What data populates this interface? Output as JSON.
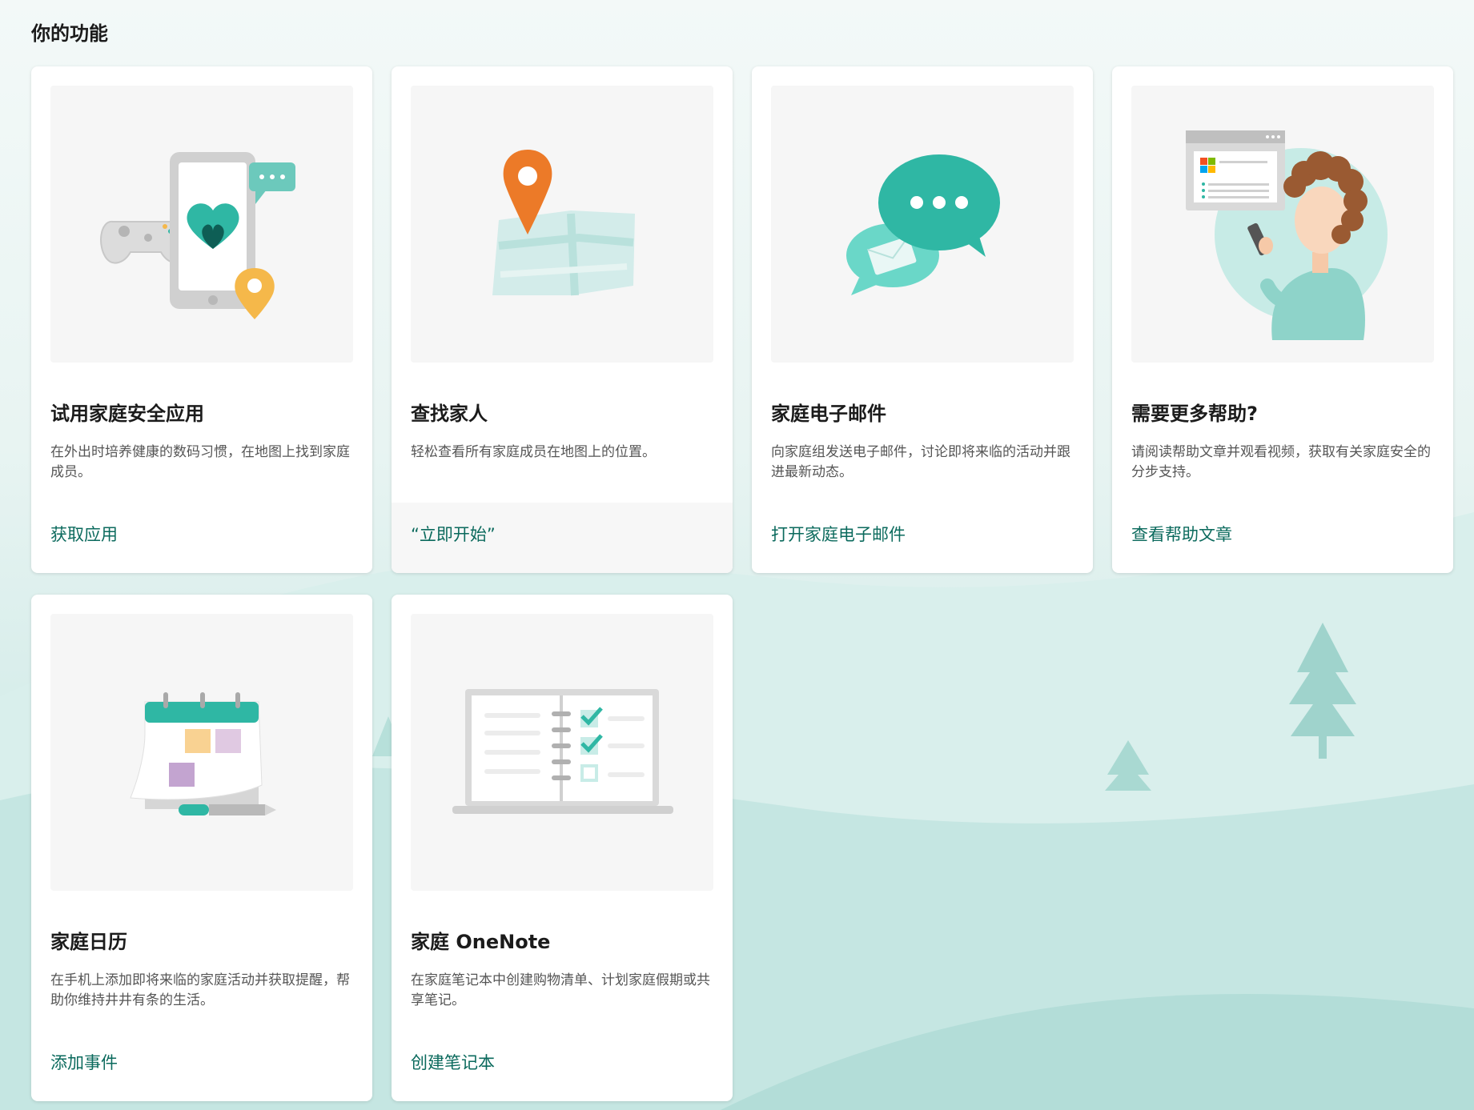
{
  "page": {
    "title": "你的功能"
  },
  "colors": {
    "accent": "#0b6a5d",
    "teal": "#2fb7a4",
    "orange": "#ec7a28",
    "yellow": "#f5b84a"
  },
  "cards": [
    {
      "title": "试用家庭安全应用",
      "description": "在外出时培养健康的数码习惯，在地图上找到家庭成员。",
      "link": "获取应用",
      "icon": "family-safety-app-illustration"
    },
    {
      "title": "查找家人",
      "description": "轻松查看所有家庭成员在地图上的位置。",
      "link": "“立即开始”",
      "icon": "map-location-illustration"
    },
    {
      "title": "家庭电子邮件",
      "description": "向家庭组发送电子邮件，讨论即将来临的活动并跟进最新动态。",
      "link": "打开家庭电子邮件",
      "icon": "email-chat-illustration"
    },
    {
      "title": "需要更多帮助?",
      "description": "请阅读帮助文章并观看视频，获取有关家庭安全的分步支持。",
      "link": "查看帮助文章",
      "icon": "help-person-illustration"
    },
    {
      "title": "家庭日历",
      "description": "在手机上添加即将来临的家庭活动并获取提醒，帮助你维持井井有条的生活。",
      "link": "添加事件",
      "icon": "calendar-illustration"
    },
    {
      "title": "家庭 OneNote",
      "description": "在家庭笔记本中创建购物清单、计划家庭假期或共享笔记。",
      "link": "创建笔记本",
      "icon": "notebook-illustration"
    }
  ]
}
